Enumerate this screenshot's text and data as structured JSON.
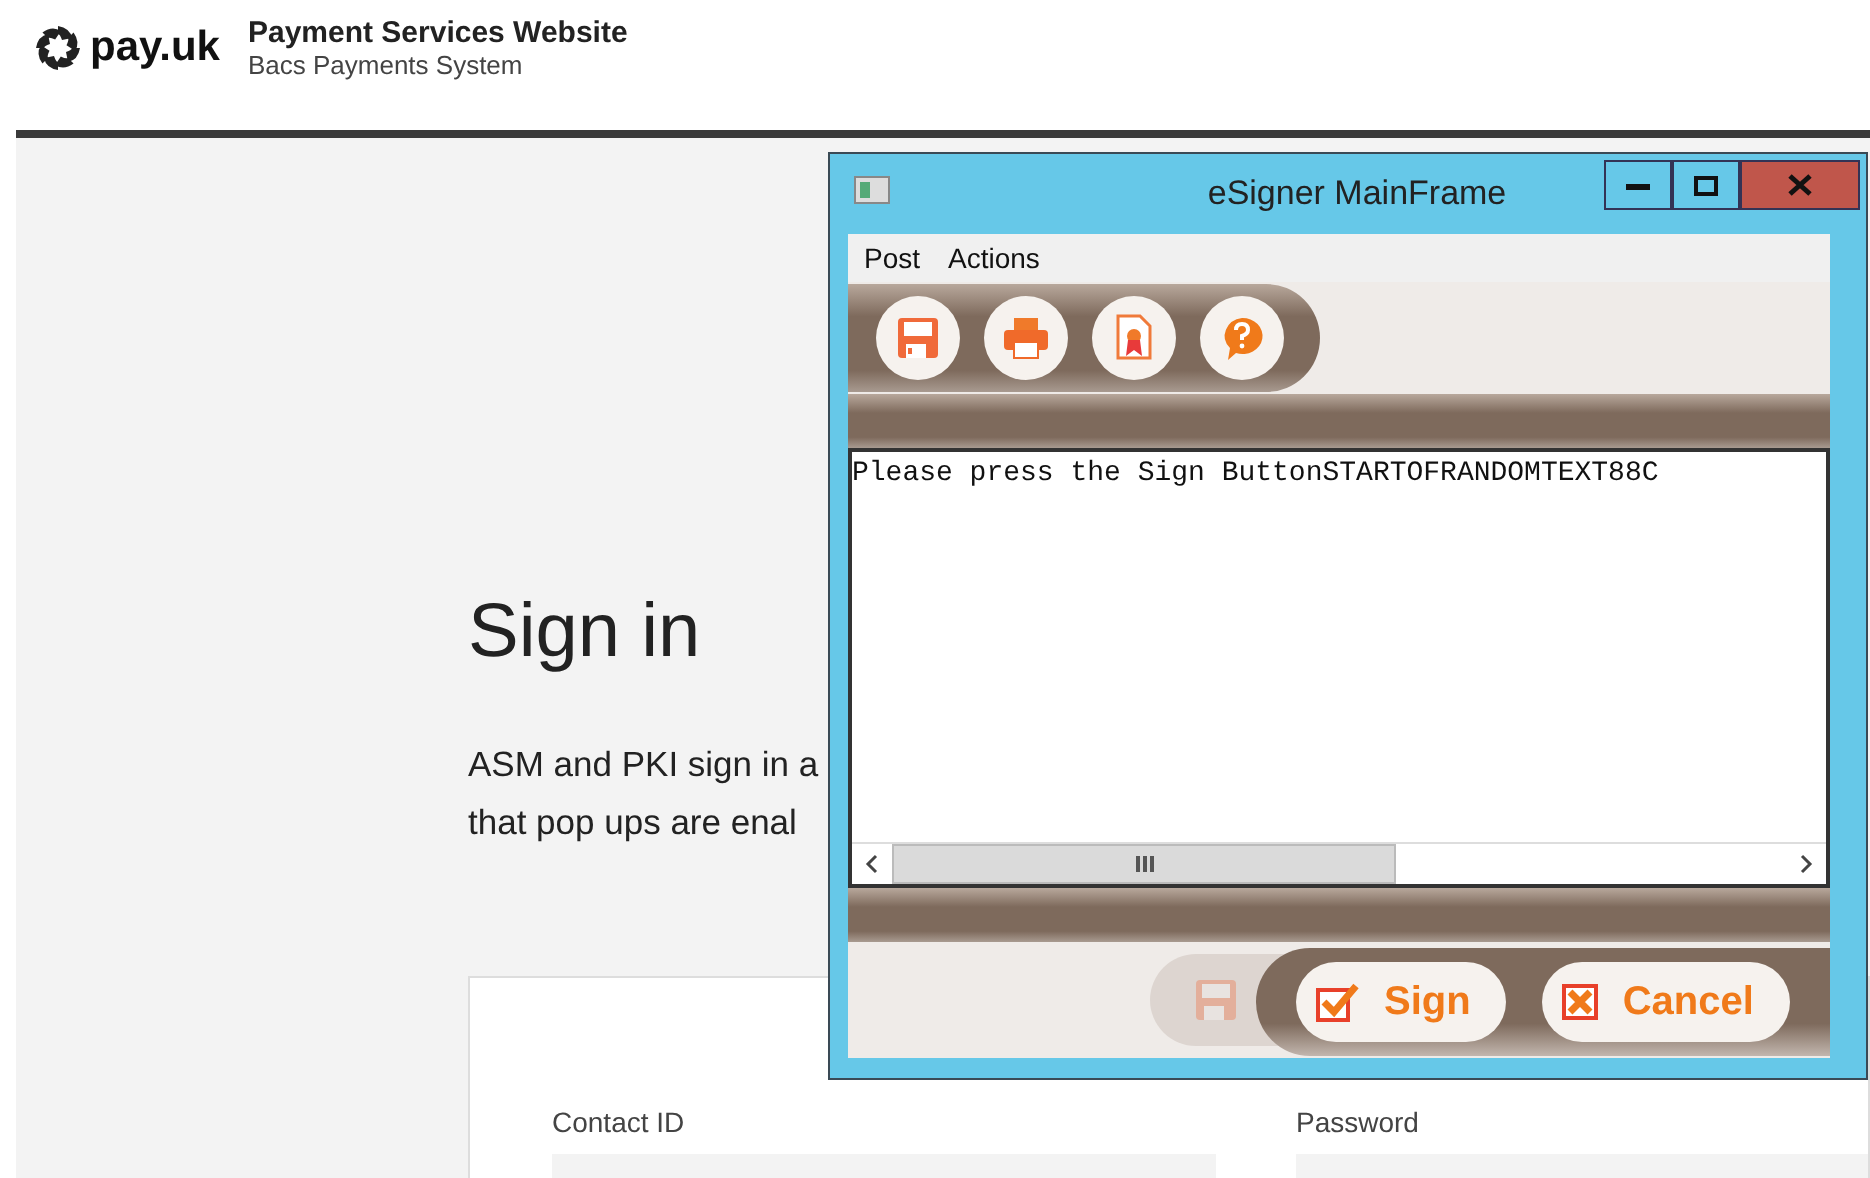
{
  "header": {
    "brand": "pay.uk",
    "title": "Payment Services Website",
    "subtitle": "Bacs Payments System"
  },
  "page": {
    "heading": "Sign in",
    "intro_lines": [
      "ASM and PKI sign in a",
      "that pop ups are enal"
    ],
    "form": {
      "fields": [
        {
          "label": "Contact ID"
        },
        {
          "label": "Password"
        }
      ]
    }
  },
  "dialog": {
    "title": "eSigner MainFrame",
    "menu": [
      "Post",
      "Actions"
    ],
    "toolbar": [
      {
        "kind": "save"
      },
      {
        "kind": "print"
      },
      {
        "kind": "certificate"
      },
      {
        "kind": "help"
      }
    ],
    "message": "Please press the Sign ButtonSTARTOFRANDOMTEXT88C",
    "actions": [
      {
        "kind": "sign",
        "label": "Sign"
      },
      {
        "kind": "cancel",
        "label": "Cancel"
      }
    ]
  }
}
